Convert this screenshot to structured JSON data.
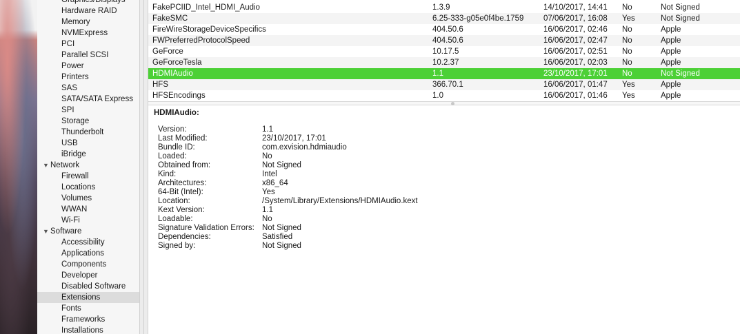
{
  "sidebar": {
    "items": [
      {
        "label": "Graphics/Displays",
        "type": "child"
      },
      {
        "label": "Hardware RAID",
        "type": "child"
      },
      {
        "label": "Memory",
        "type": "child"
      },
      {
        "label": "NVMExpress",
        "type": "child"
      },
      {
        "label": "PCI",
        "type": "child"
      },
      {
        "label": "Parallel SCSI",
        "type": "child"
      },
      {
        "label": "Power",
        "type": "child"
      },
      {
        "label": "Printers",
        "type": "child"
      },
      {
        "label": "SAS",
        "type": "child"
      },
      {
        "label": "SATA/SATA Express",
        "type": "child"
      },
      {
        "label": "SPI",
        "type": "child"
      },
      {
        "label": "Storage",
        "type": "child"
      },
      {
        "label": "Thunderbolt",
        "type": "child"
      },
      {
        "label": "USB",
        "type": "child"
      },
      {
        "label": "iBridge",
        "type": "child"
      },
      {
        "label": "Network",
        "type": "group"
      },
      {
        "label": "Firewall",
        "type": "child"
      },
      {
        "label": "Locations",
        "type": "child"
      },
      {
        "label": "Volumes",
        "type": "child"
      },
      {
        "label": "WWAN",
        "type": "child"
      },
      {
        "label": "Wi-Fi",
        "type": "child"
      },
      {
        "label": "Software",
        "type": "group"
      },
      {
        "label": "Accessibility",
        "type": "child"
      },
      {
        "label": "Applications",
        "type": "child"
      },
      {
        "label": "Components",
        "type": "child"
      },
      {
        "label": "Developer",
        "type": "child"
      },
      {
        "label": "Disabled Software",
        "type": "child"
      },
      {
        "label": "Extensions",
        "type": "child",
        "selected": true
      },
      {
        "label": "Fonts",
        "type": "child"
      },
      {
        "label": "Frameworks",
        "type": "child"
      },
      {
        "label": "Installations",
        "type": "child"
      }
    ]
  },
  "table": {
    "rows": [
      {
        "name": "FakePCIID_Intel_HDMI_Audio",
        "version": "1.3.9",
        "modified": "14/10/2017, 14:41",
        "loaded": "No",
        "obtained": "Not Signed"
      },
      {
        "name": "FakeSMC",
        "version": "6.25-333-g05e0f4be.1759",
        "modified": "07/06/2017, 16:08",
        "loaded": "Yes",
        "obtained": "Not Signed"
      },
      {
        "name": "FireWireStorageDeviceSpecifics",
        "version": "404.50.6",
        "modified": "16/06/2017, 02:46",
        "loaded": "No",
        "obtained": "Apple"
      },
      {
        "name": "FWPreferredProtocolSpeed",
        "version": "404.50.6",
        "modified": "16/06/2017, 02:47",
        "loaded": "No",
        "obtained": "Apple"
      },
      {
        "name": "GeForce",
        "version": "10.17.5",
        "modified": "16/06/2017, 02:51",
        "loaded": "No",
        "obtained": "Apple"
      },
      {
        "name": "GeForceTesla",
        "version": "10.2.37",
        "modified": "16/06/2017, 02:03",
        "loaded": "No",
        "obtained": "Apple"
      },
      {
        "name": "HDMIAudio",
        "version": "1.1",
        "modified": "23/10/2017, 17:01",
        "loaded": "No",
        "obtained": "Not Signed",
        "selected": true
      },
      {
        "name": "HFS",
        "version": "366.70.1",
        "modified": "16/06/2017, 01:47",
        "loaded": "Yes",
        "obtained": "Apple"
      },
      {
        "name": "HFSEncodings",
        "version": "1.0",
        "modified": "16/06/2017, 01:46",
        "loaded": "Yes",
        "obtained": "Apple"
      }
    ]
  },
  "detail": {
    "title": "HDMIAudio:",
    "fields": [
      {
        "key": "Version:",
        "value": "1.1"
      },
      {
        "key": "Last Modified:",
        "value": "23/10/2017, 17:01"
      },
      {
        "key": "Bundle ID:",
        "value": "com.exvision.hdmiaudio"
      },
      {
        "key": "Loaded:",
        "value": "No"
      },
      {
        "key": "Obtained from:",
        "value": "Not Signed"
      },
      {
        "key": "Kind:",
        "value": "Intel"
      },
      {
        "key": "Architectures:",
        "value": "x86_64"
      },
      {
        "key": "64-Bit (Intel):",
        "value": "Yes"
      },
      {
        "key": "Location:",
        "value": "/System/Library/Extensions/HDMIAudio.kext"
      },
      {
        "key": "Kext Version:",
        "value": "1.1"
      },
      {
        "key": "Loadable:",
        "value": "No"
      },
      {
        "key": "Signature Validation Errors:",
        "value": "Not Signed"
      },
      {
        "key": "Dependencies:",
        "value": "Satisfied"
      },
      {
        "key": "Signed by:",
        "value": "Not Signed"
      }
    ]
  },
  "colors": {
    "selection_green": "#4cd036",
    "sidebar_selected": "#dcdcdc"
  }
}
